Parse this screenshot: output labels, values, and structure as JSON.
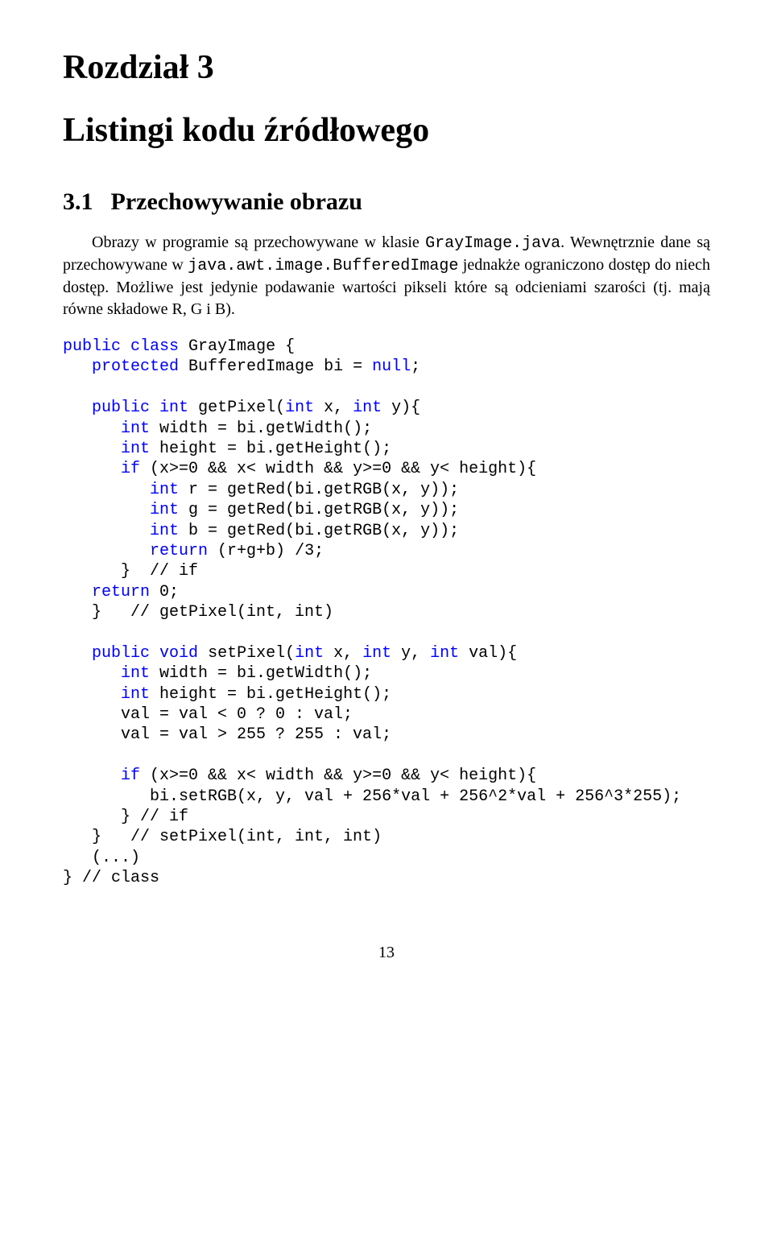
{
  "chapter": {
    "label": "Rozdział 3",
    "title": "Listingi kodu źródłowego"
  },
  "section": {
    "number": "3.1",
    "title": "Przechowywanie obrazu"
  },
  "paragraph": {
    "p1a": "Obrazy w programie są przechowywane w klasie ",
    "p1b": "GrayImage.java",
    "p1c": ". Wewnętrznie dane są przechowywane w ",
    "p1d": "java.awt.image.BufferedImage",
    "p1e": " jednakże ograniczono dostęp do niech dostęp. Możliwe jest jedynie podawanie wartości pikseli które są odcieniami szarości (tj. mają równe składowe R, G i B)."
  },
  "code": {
    "l01a": "public",
    "l01b": " ",
    "l01c": "class",
    "l01d": " GrayImage {",
    "l02a": "   ",
    "l02b": "protected",
    "l02c": " BufferedImage bi = ",
    "l02d": "null",
    "l02e": ";",
    "l03": "",
    "l04a": "   ",
    "l04b": "public",
    "l04c": " ",
    "l04d": "int",
    "l04e": " getPixel(",
    "l04f": "int",
    "l04g": " x, ",
    "l04h": "int",
    "l04i": " y){",
    "l05a": "      ",
    "l05b": "int",
    "l05c": " width = bi.getWidth();",
    "l06a": "      ",
    "l06b": "int",
    "l06c": " height = bi.getHeight();",
    "l07a": "      ",
    "l07b": "if",
    "l07c": " (x>=0 && x< width && y>=0 && y< height){",
    "l08a": "         ",
    "l08b": "int",
    "l08c": " r = getRed(bi.getRGB(x, y));",
    "l09a": "         ",
    "l09b": "int",
    "l09c": " g = getRed(bi.getRGB(x, y));",
    "l10a": "         ",
    "l10b": "int",
    "l10c": " b = getRed(bi.getRGB(x, y));",
    "l11a": "         ",
    "l11b": "return",
    "l11c": " (r+g+b) /3;",
    "l12": "      }  // if",
    "l13a": "   ",
    "l13b": "return",
    "l13c": " 0;",
    "l14": "   }   // getPixel(int, int)",
    "l15": "",
    "l16a": "   ",
    "l16b": "public",
    "l16c": " ",
    "l16d": "void",
    "l16e": " setPixel(",
    "l16f": "int",
    "l16g": " x, ",
    "l16h": "int",
    "l16i": " y, ",
    "l16j": "int",
    "l16k": " val){",
    "l17a": "      ",
    "l17b": "int",
    "l17c": " width = bi.getWidth();",
    "l18a": "      ",
    "l18b": "int",
    "l18c": " height = bi.getHeight();",
    "l19": "      val = val < 0 ? 0 : val;",
    "l20": "      val = val > 255 ? 255 : val;",
    "l21": "",
    "l22a": "      ",
    "l22b": "if",
    "l22c": " (x>=0 && x< width && y>=0 && y< height){",
    "l23": "         bi.setRGB(x, y, val + 256*val + 256^2*val + 256^3*255);",
    "l24": "      } // if",
    "l25": "   }   // setPixel(int, int, int)",
    "l26": "   (...)",
    "l27": "} // class"
  },
  "pageNumber": "13"
}
